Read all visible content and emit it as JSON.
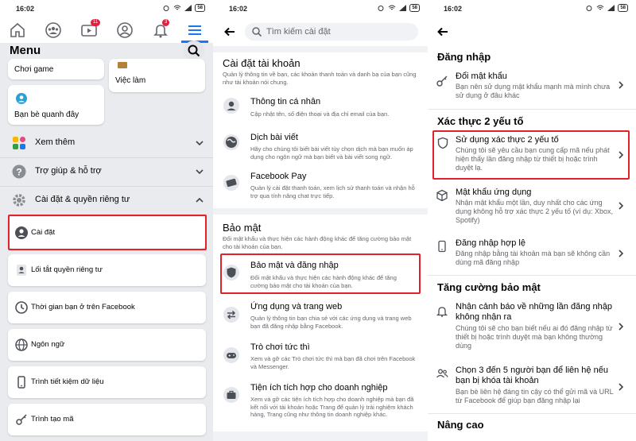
{
  "status": {
    "time": "16:02",
    "battery": "58"
  },
  "screen1": {
    "nav": {
      "video_badge": "11",
      "bell_badge": "3"
    },
    "title": "Menu",
    "cards": {
      "game": "Chơi game",
      "jobs": "Việc làm",
      "nearby": "Bạn bè quanh đây"
    },
    "rows": {
      "see_more": "Xem thêm",
      "help": "Trợ giúp & hỗ trợ",
      "settings_privacy": "Cài đặt & quyền riêng tư"
    },
    "settings_items": [
      "Cài đặt",
      "Lối tắt quyền riêng tư",
      "Thời gian bạn ở trên Facebook",
      "Ngôn ngữ",
      "Trình tiết kiệm dữ liệu",
      "Trình tạo mã"
    ]
  },
  "screen2": {
    "search_placeholder": "Tìm kiếm cài đặt",
    "account": {
      "title": "Cài đặt tài khoản",
      "subtitle": "Quản lý thông tin về bạn, các khoản thanh toán và danh bạ của bạn cũng như tài khoản nói chung.",
      "items": [
        {
          "title": "Thông tin cá nhân",
          "desc": "Cập nhật tên, số điện thoại và địa chỉ email của bạn."
        },
        {
          "title": "Dịch bài viết",
          "desc": "Hãy cho chúng tôi biết bài viết tùy chọn dịch mà bạn muốn áp dụng cho ngôn ngữ mà bạn biết và bài viết song ngữ."
        },
        {
          "title": "Facebook Pay",
          "desc": "Quản lý cài đặt thanh toán, xem lịch sử thanh toán và nhận hỗ trợ qua tính năng chat trực tiếp."
        }
      ]
    },
    "security": {
      "title": "Bảo mật",
      "subtitle": "Đổi mật khẩu và thực hiện các hành động khác để tăng cường bảo mật cho tài khoản của bạn.",
      "items": [
        {
          "title": "Bảo mật và đăng nhập",
          "desc": "Đổi mật khẩu và thực hiện các hành động khác để tăng cường bảo mật cho tài khoản của bạn."
        },
        {
          "title": "Ứng dụng và trang web",
          "desc": "Quản lý thông tin bạn chia sẻ với các ứng dụng và trang web bạn đã đăng nhập bằng Facebook."
        },
        {
          "title": "Trò chơi tức thì",
          "desc": "Xem và gỡ các Trò chơi tức thì mà bạn đã chơi trên Facebook và Messenger."
        },
        {
          "title": "Tiện ích tích hợp cho doanh nghiệp",
          "desc": "Xem và gỡ các tiện ích tích hợp cho doanh nghiệp mà bạn đã kết nối với tài khoản hoặc Trang để quản lý trải nghiệm khách hàng, Trang cũng như thông tin doanh nghiệp khác."
        }
      ]
    }
  },
  "screen3": {
    "login": {
      "title": "Đăng nhập",
      "items": [
        {
          "title": "Đổi mật khẩu",
          "desc": "Bạn nên sử dụng mật khẩu mạnh mà mình chưa sử dụng ở đâu khác"
        }
      ]
    },
    "twofa": {
      "title": "Xác thực 2 yếu tố",
      "items": [
        {
          "title": "Sử dụng xác thực 2 yếu tố",
          "desc": "Chúng tôi sẽ yêu cầu bạn cung cấp mã nếu phát hiện thấy lần đăng nhập từ thiết bị hoặc trình duyệt lạ."
        },
        {
          "title": "Mật khẩu ứng dụng",
          "desc": "Nhận mật khẩu một lần, duy nhất cho các ứng dụng không hỗ trợ xác thực 2 yếu tố (ví dụ: Xbox, Spotify)"
        },
        {
          "title": "Đăng nhập hợp lệ",
          "desc": "Đăng nhập bằng tài khoản mà bạn sẽ không cần dùng mã đăng nhập"
        }
      ]
    },
    "extra": {
      "title": "Tăng cường bảo mật",
      "items": [
        {
          "title": "Nhận cảnh báo về những lần đăng nhập không nhận ra",
          "desc": "Chúng tôi sẽ cho bạn biết nếu ai đó đăng nhập từ thiết bị hoặc trình duyệt mà bạn không thường dùng"
        },
        {
          "title": "Chọn 3 đến 5 người bạn để liên hệ nếu bạn bị khóa tài khoản",
          "desc": "Bạn bè liên hệ đáng tin cậy có thể gửi mã và URL từ Facebook để giúp bạn đăng nhập lại"
        }
      ]
    },
    "advanced": {
      "title": "Nâng cao"
    }
  },
  "colors": {
    "accent": "#1877f2",
    "highlight": "#e0222a",
    "badge": "#e41e3f"
  }
}
